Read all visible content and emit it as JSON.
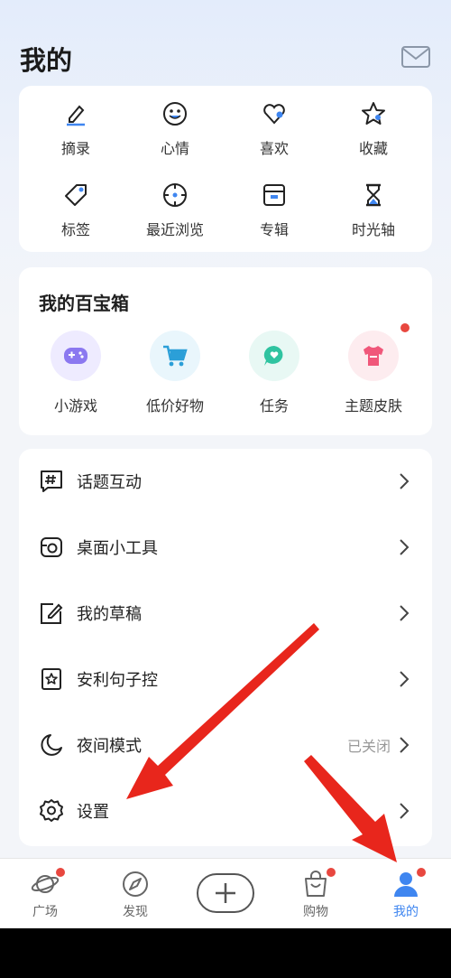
{
  "header": {
    "title": "我的",
    "mail_icon": "mail-icon"
  },
  "quick_grid": [
    {
      "label": "摘录",
      "icon": "pencil-icon"
    },
    {
      "label": "心情",
      "icon": "smiley-icon"
    },
    {
      "label": "喜欢",
      "icon": "heart-icon"
    },
    {
      "label": "收藏",
      "icon": "star-icon"
    },
    {
      "label": "标签",
      "icon": "tag-icon"
    },
    {
      "label": "最近浏览",
      "icon": "clock-icon"
    },
    {
      "label": "专辑",
      "icon": "album-icon"
    },
    {
      "label": "时光轴",
      "icon": "hourglass-icon"
    }
  ],
  "toolbox": {
    "title": "我的百宝箱",
    "items": [
      {
        "label": "小游戏",
        "icon": "gamepad-icon",
        "color": "#eeebff"
      },
      {
        "label": "低价好物",
        "icon": "cart-icon",
        "color": "#e9f6fc"
      },
      {
        "label": "任务",
        "icon": "chat-bubble-icon",
        "color": "#e8f8f4"
      },
      {
        "label": "主题皮肤",
        "icon": "tshirt-icon",
        "color": "#fdecef",
        "badge": true
      }
    ]
  },
  "menu": [
    {
      "label": "话题互动",
      "icon": "hashtag-icon",
      "value": ""
    },
    {
      "label": "桌面小工具",
      "icon": "widget-icon",
      "value": ""
    },
    {
      "label": "我的草稿",
      "icon": "draft-icon",
      "value": ""
    },
    {
      "label": "安利句子控",
      "icon": "bookmark-star-icon",
      "value": ""
    },
    {
      "label": "夜间模式",
      "icon": "moon-icon",
      "value": "已关闭"
    },
    {
      "label": "设置",
      "icon": "gear-icon",
      "value": ""
    }
  ],
  "bottom_nav": [
    {
      "label": "广场",
      "icon": "planet-icon",
      "badge": true
    },
    {
      "label": "发现",
      "icon": "compass-icon",
      "badge": false
    },
    {
      "label": "",
      "icon": "plus-icon",
      "badge": false
    },
    {
      "label": "购物",
      "icon": "shopping-bag-icon",
      "badge": true
    },
    {
      "label": "我的",
      "icon": "user-icon",
      "badge": true,
      "active": true
    }
  ],
  "colors": {
    "accent": "#3f86f0",
    "badge": "#e8473f",
    "annotation_arrow": "#e8261c"
  }
}
